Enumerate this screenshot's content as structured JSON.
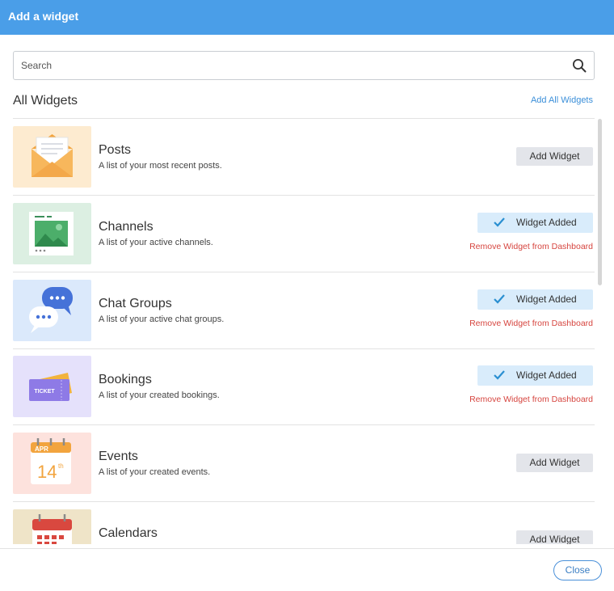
{
  "header": {
    "title": "Add a widget"
  },
  "search": {
    "placeholder": "Search",
    "value": ""
  },
  "section": {
    "title": "All Widgets",
    "add_all_label": "Add All Widgets"
  },
  "widgets": [
    {
      "title": "Posts",
      "description": "A list of your most recent posts.",
      "status": "available",
      "add_label": "Add Widget"
    },
    {
      "title": "Channels",
      "description": "A list of your active channels.",
      "status": "added",
      "added_label": "Widget Added",
      "remove_label": "Remove Widget from Dashboard"
    },
    {
      "title": "Chat Groups",
      "description": "A list of your active chat groups.",
      "status": "added",
      "added_label": "Widget Added",
      "remove_label": "Remove Widget from Dashboard"
    },
    {
      "title": "Bookings",
      "description": "A list of your created bookings.",
      "status": "added",
      "added_label": "Widget Added",
      "remove_label": "Remove Widget from Dashboard"
    },
    {
      "title": "Events",
      "description": "A list of your created events.",
      "status": "available",
      "add_label": "Add Widget",
      "icon_text": {
        "month": "APR",
        "day": "14",
        "suffix": "th"
      }
    },
    {
      "title": "Calendars",
      "description": "",
      "status": "available",
      "add_label": "Add Widget"
    }
  ],
  "icons": {
    "posts": "envelope-icon",
    "channels": "image-card-icon",
    "chat_groups": "chat-bubbles-icon",
    "bookings": "ticket-icon",
    "events": "calendar-date-icon",
    "calendars": "calendar-icon"
  },
  "ticket_text": "TICKET",
  "footer": {
    "close_label": "Close"
  },
  "colors": {
    "header": "#4a9ee8",
    "link": "#3b8fd9",
    "remove": "#d6453f",
    "added_bg": "#d9ecfb",
    "check": "#2a8fd1",
    "add_bg": "#e3e5ea"
  }
}
